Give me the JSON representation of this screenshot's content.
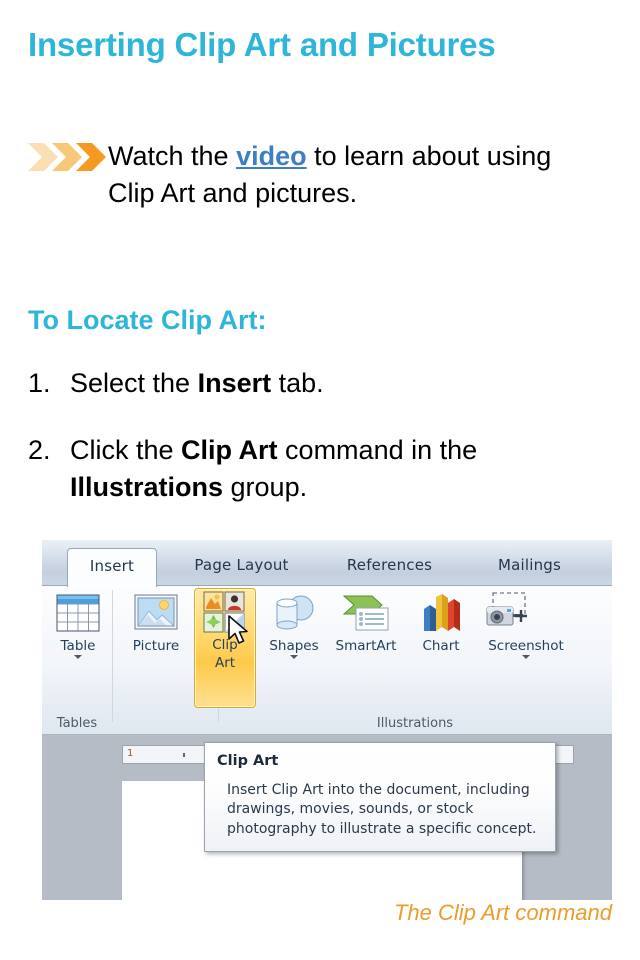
{
  "slide": {
    "title": "Inserting Clip Art and Pictures",
    "bullet": {
      "icon": "triple-chevron-bullet",
      "text_before": "Watch the ",
      "link_text": "video",
      "text_after": " to learn about using Clip Art and pictures."
    },
    "section_heading": "To Locate Clip Art:",
    "steps": [
      {
        "number": "1.",
        "before": "Select the ",
        "bold": "Insert",
        "after": " tab."
      },
      {
        "number": "2.",
        "before": "Click the ",
        "bold": "Clip Art",
        "mid": " command in the ",
        "bold2": "Illustrations",
        "after": " group."
      }
    ],
    "caption": "The Clip Art command"
  },
  "screenshot": {
    "tabs": [
      {
        "label": "Insert",
        "active": true
      },
      {
        "label": "Page Layout",
        "active": false
      },
      {
        "label": "References",
        "active": false
      },
      {
        "label": "Mailings",
        "active": false
      }
    ],
    "groups": [
      {
        "label": "Tables"
      },
      {
        "label": "Illustrations"
      }
    ],
    "commands": [
      {
        "label": "Table",
        "icon": "table-icon",
        "has_caret": true,
        "highlighted": false
      },
      {
        "label": "Picture",
        "icon": "picture-icon",
        "has_caret": false,
        "highlighted": false
      },
      {
        "label": "Clip Art",
        "label_line1": "Clip",
        "label_line2": "Art",
        "icon": "clip-art-icon",
        "has_caret": false,
        "highlighted": true
      },
      {
        "label": "Shapes",
        "icon": "shapes-icon",
        "has_caret": true,
        "highlighted": false
      },
      {
        "label": "SmartArt",
        "icon": "smartart-icon",
        "has_caret": false,
        "highlighted": false
      },
      {
        "label": "Chart",
        "icon": "chart-icon",
        "has_caret": false,
        "highlighted": false
      },
      {
        "label": "Screenshot",
        "icon": "screenshot-icon",
        "has_caret": true,
        "highlighted": false
      }
    ],
    "cursor": "mouse-pointer",
    "ruler_mark": "1",
    "tooltip": {
      "title": "Clip Art",
      "body": "Insert Clip Art into the document, including drawings, movies, sounds, or stock photography to illustrate a specific concept."
    }
  },
  "colors": {
    "heading": "#2db5da",
    "link": "#3b7fc4",
    "caption": "#ef9b2a",
    "bullet_light": "#fadfb5",
    "bullet_mid": "#f8c87a",
    "bullet_dark": "#f59a20",
    "highlight": "#fdc94a"
  }
}
